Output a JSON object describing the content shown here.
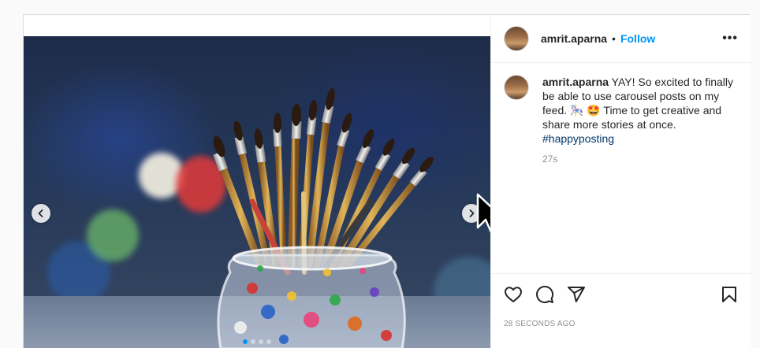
{
  "post": {
    "author": {
      "username": "amrit.aparna",
      "separator": "•",
      "follow_label": "Follow",
      "more_label": "•••"
    },
    "caption": {
      "username": "amrit.aparna",
      "text_before_tag": " YAY! So excited to finally be able to use carousel posts on my feed. 🎠 🤩 Time to get creative and share more stories at once. ",
      "hashtag": "#happyposting",
      "relative_time": "27s"
    },
    "actions": {
      "like_icon": "heart-icon",
      "comment_icon": "comment-icon",
      "share_icon": "share-icon",
      "save_icon": "bookmark-icon"
    },
    "timestamp": "28 SECONDS AGO",
    "carousel": {
      "prev_icon": "chevron-left-icon",
      "next_icon": "chevron-right-icon",
      "slide_count": 4,
      "current_slide_index": 0
    }
  },
  "colors": {
    "accent": "#0095f6",
    "hashtag": "#00376b",
    "muted_text": "#8e8e8e",
    "primary_text": "#262626",
    "border": "#dbdbdb"
  }
}
